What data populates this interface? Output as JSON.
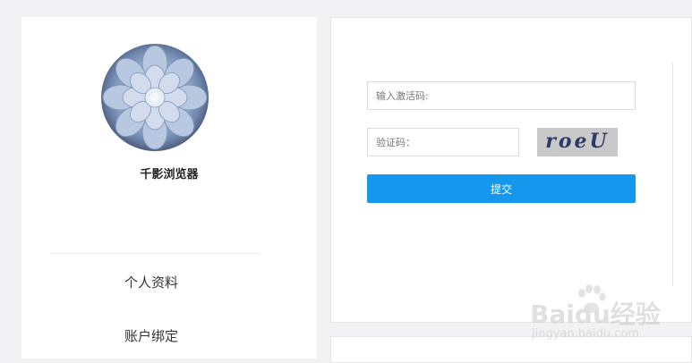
{
  "sidebar": {
    "username": "千影浏览器",
    "menu": [
      {
        "label": "个人资料"
      },
      {
        "label": "账户绑定"
      }
    ]
  },
  "activation_form": {
    "code_placeholder": "输入激活码:",
    "captcha_placeholder": "验证码：",
    "captcha_text": "roeU",
    "submit_label": "提交"
  },
  "watermark": {
    "logo": "Baidu经验",
    "url": "jingyan.baidu.com"
  }
}
